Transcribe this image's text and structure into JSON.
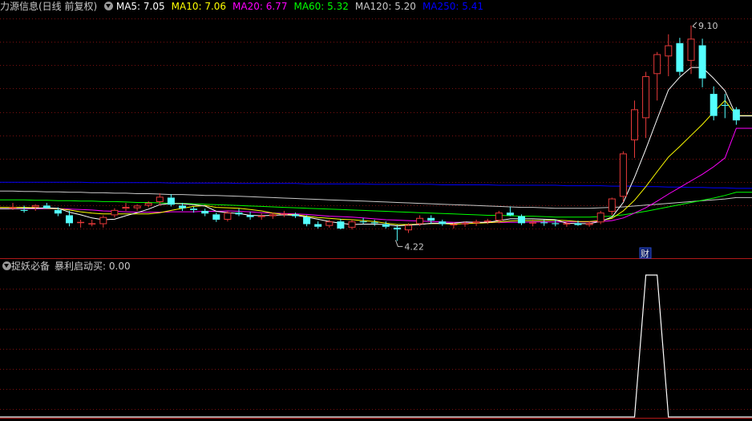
{
  "main_header": {
    "title": "力源信息(日线 前复权)",
    "ma": [
      {
        "label": "MA5: ",
        "value": "7.05",
        "color": "#ffffff"
      },
      {
        "label": "MA10: ",
        "value": "7.06",
        "color": "#ffff00"
      },
      {
        "label": "MA20: ",
        "value": "6.77",
        "color": "#ff00ff"
      },
      {
        "label": "MA60: ",
        "value": "5.32",
        "color": "#00ff00"
      },
      {
        "label": "MA120: ",
        "value": "5.20",
        "color": "#c8c8c8"
      },
      {
        "label": "MA250: ",
        "value": "5.41",
        "color": "#0000ff"
      }
    ]
  },
  "sub_header": {
    "title": "捉妖必备",
    "indicator_label": "暴利启动买: ",
    "indicator_value": "0.00"
  },
  "annotations": {
    "high_label": "9.10",
    "low_label": "4.22",
    "event_marker": "财"
  },
  "colors": {
    "background": "#000000",
    "grid": "#7a1010",
    "up": "#e83a3a",
    "down": "#54ffff",
    "panel_border": "#b01818"
  },
  "chart_data": [
    {
      "type": "candlestick",
      "title": "力源信息(日线 前复权)",
      "ylim": [
        3.9,
        9.35
      ],
      "gridlines": "dotted horizontal",
      "high": {
        "price": 9.1,
        "index": 60
      },
      "low": {
        "price": 4.22,
        "index": 34
      },
      "ohlc": [
        [
          4.95,
          5.08,
          4.92,
          4.98
        ],
        [
          4.92,
          5.02,
          4.86,
          4.9
        ],
        [
          4.98,
          5.05,
          4.9,
          5.03
        ],
        [
          5.02,
          5.08,
          4.95,
          4.96
        ],
        [
          4.92,
          4.98,
          4.78,
          4.84
        ],
        [
          4.8,
          4.9,
          4.55,
          4.62
        ],
        [
          4.65,
          4.7,
          4.52,
          4.65
        ],
        [
          4.62,
          4.7,
          4.55,
          4.62
        ],
        [
          4.6,
          4.8,
          4.52,
          4.76
        ],
        [
          4.8,
          4.96,
          4.75,
          4.92
        ],
        [
          4.95,
          5.08,
          4.9,
          4.99
        ],
        [
          4.96,
          5.05,
          4.9,
          5.02
        ],
        [
          5.02,
          5.12,
          4.98,
          5.08
        ],
        [
          5.1,
          5.3,
          5.02,
          5.22
        ],
        [
          5.2,
          5.28,
          5.0,
          5.04
        ],
        [
          5.02,
          5.08,
          4.9,
          4.96
        ],
        [
          4.95,
          4.99,
          4.86,
          4.92
        ],
        [
          4.9,
          4.95,
          4.78,
          4.84
        ],
        [
          4.82,
          4.86,
          4.65,
          4.7
        ],
        [
          4.7,
          4.9,
          4.66,
          4.86
        ],
        [
          4.86,
          4.95,
          4.78,
          4.82
        ],
        [
          4.8,
          4.88,
          4.7,
          4.76
        ],
        [
          4.76,
          4.84,
          4.7,
          4.79
        ],
        [
          4.78,
          4.86,
          4.72,
          4.82
        ],
        [
          4.82,
          4.9,
          4.76,
          4.84
        ],
        [
          4.82,
          4.86,
          4.74,
          4.78
        ],
        [
          4.76,
          4.8,
          4.55,
          4.6
        ],
        [
          4.6,
          4.66,
          4.5,
          4.54
        ],
        [
          4.56,
          4.7,
          4.52,
          4.66
        ],
        [
          4.66,
          4.72,
          4.48,
          4.5
        ],
        [
          4.52,
          4.7,
          4.48,
          4.66
        ],
        [
          4.66,
          4.74,
          4.6,
          4.64
        ],
        [
          4.64,
          4.7,
          4.56,
          4.62
        ],
        [
          4.6,
          4.66,
          4.5,
          4.54
        ],
        [
          4.52,
          4.58,
          4.22,
          4.48
        ],
        [
          4.46,
          4.62,
          4.4,
          4.58
        ],
        [
          4.6,
          4.8,
          4.56,
          4.74
        ],
        [
          4.74,
          4.8,
          4.6,
          4.68
        ],
        [
          4.66,
          4.7,
          4.56,
          4.6
        ],
        [
          4.58,
          4.64,
          4.5,
          4.6
        ],
        [
          4.6,
          4.66,
          4.54,
          4.62
        ],
        [
          4.62,
          4.7,
          4.56,
          4.66
        ],
        [
          4.66,
          4.72,
          4.6,
          4.68
        ],
        [
          4.68,
          4.9,
          4.62,
          4.86
        ],
        [
          4.86,
          5.0,
          4.78,
          4.8
        ],
        [
          4.78,
          4.82,
          4.58,
          4.62
        ],
        [
          4.62,
          4.7,
          4.55,
          4.64
        ],
        [
          4.64,
          4.7,
          4.56,
          4.62
        ],
        [
          4.62,
          4.7,
          4.55,
          4.6
        ],
        [
          4.6,
          4.66,
          4.54,
          4.62
        ],
        [
          4.62,
          4.68,
          4.56,
          4.58
        ],
        [
          4.58,
          4.66,
          4.54,
          4.62
        ],
        [
          4.64,
          4.9,
          4.6,
          4.86
        ],
        [
          4.88,
          5.2,
          4.8,
          5.18
        ],
        [
          5.22,
          6.25,
          5.1,
          6.2
        ],
        [
          6.5,
          7.4,
          6.1,
          7.2
        ],
        [
          7.0,
          8.05,
          6.55,
          7.95
        ],
        [
          8.0,
          8.5,
          7.4,
          8.45
        ],
        [
          8.4,
          8.9,
          7.95,
          8.65
        ],
        [
          8.7,
          8.82,
          7.96,
          8.05
        ],
        [
          8.3,
          9.1,
          8.0,
          8.8
        ],
        [
          8.65,
          8.8,
          7.7,
          7.9
        ],
        [
          7.55,
          7.72,
          6.95,
          7.05
        ],
        [
          7.3,
          7.55,
          7.0,
          7.28
        ],
        [
          7.2,
          7.25,
          6.85,
          6.95
        ]
      ],
      "ma_series": [
        {
          "name": "MA5",
          "color": "#ffffff",
          "values": [
            4.95,
            4.96,
            4.96,
            4.97,
            4.96,
            4.87,
            4.81,
            4.74,
            4.7,
            4.71,
            4.79,
            4.86,
            4.94,
            5.04,
            5.07,
            5.06,
            5.04,
            5.01,
            4.89,
            4.86,
            4.84,
            4.8,
            4.79,
            4.8,
            4.81,
            4.8,
            4.76,
            4.71,
            4.66,
            4.62,
            4.59,
            4.6,
            4.6,
            4.59,
            4.56,
            4.58,
            4.59,
            4.62,
            4.62,
            4.62,
            4.65,
            4.64,
            4.64,
            4.68,
            4.72,
            4.72,
            4.72,
            4.71,
            4.7,
            4.62,
            4.61,
            4.61,
            4.66,
            4.76,
            5.09,
            5.66,
            6.3,
            6.98,
            7.64,
            7.93,
            8.15,
            8.15,
            7.9,
            7.62,
            7.05
          ]
        },
        {
          "name": "MA10",
          "color": "#ffff00",
          "values": [
            4.98,
            4.98,
            4.97,
            4.96,
            4.95,
            4.92,
            4.88,
            4.85,
            4.83,
            4.83,
            4.83,
            4.83,
            4.83,
            4.86,
            4.91,
            4.96,
            5.0,
            5.02,
            4.98,
            4.97,
            4.96,
            4.93,
            4.9,
            4.85,
            4.82,
            4.82,
            4.78,
            4.75,
            4.73,
            4.71,
            4.7,
            4.68,
            4.66,
            4.62,
            4.59,
            4.59,
            4.6,
            4.61,
            4.61,
            4.6,
            4.61,
            4.62,
            4.63,
            4.65,
            4.67,
            4.68,
            4.68,
            4.68,
            4.69,
            4.68,
            4.66,
            4.66,
            4.68,
            4.73,
            4.9,
            5.14,
            5.45,
            5.79,
            6.12,
            6.36,
            6.61,
            6.86,
            7.14,
            7.4,
            7.06
          ]
        },
        {
          "name": "MA20",
          "color": "#ff00ff",
          "values": [
            4.95,
            4.95,
            4.95,
            4.95,
            4.95,
            4.94,
            4.93,
            4.92,
            4.9,
            4.89,
            4.88,
            4.87,
            4.87,
            4.87,
            4.88,
            4.88,
            4.88,
            4.89,
            4.89,
            4.9,
            4.89,
            4.88,
            4.86,
            4.85,
            4.84,
            4.83,
            4.82,
            4.8,
            4.78,
            4.77,
            4.76,
            4.74,
            4.72,
            4.7,
            4.69,
            4.68,
            4.67,
            4.66,
            4.65,
            4.64,
            4.64,
            4.64,
            4.64,
            4.64,
            4.64,
            4.64,
            4.65,
            4.65,
            4.65,
            4.65,
            4.65,
            4.65,
            4.66,
            4.68,
            4.74,
            4.85,
            4.97,
            5.12,
            5.28,
            5.43,
            5.58,
            5.73,
            5.9,
            6.1,
            6.77
          ]
        },
        {
          "name": "MA60",
          "color": "#00ff00",
          "values": [
            5.15,
            5.15,
            5.14,
            5.14,
            5.13,
            5.13,
            5.12,
            5.12,
            5.11,
            5.11,
            5.1,
            5.09,
            5.09,
            5.08,
            5.07,
            5.07,
            5.06,
            5.05,
            5.04,
            5.03,
            5.02,
            5.01,
            5.0,
            4.99,
            4.98,
            4.97,
            4.96,
            4.95,
            4.94,
            4.93,
            4.92,
            4.91,
            4.9,
            4.89,
            4.88,
            4.87,
            4.86,
            4.85,
            4.84,
            4.83,
            4.82,
            4.81,
            4.8,
            4.8,
            4.79,
            4.78,
            4.78,
            4.77,
            4.76,
            4.76,
            4.76,
            4.76,
            4.77,
            4.78,
            4.81,
            4.85,
            4.89,
            4.94,
            4.99,
            5.04,
            5.09,
            5.14,
            5.19,
            5.25,
            5.32
          ]
        },
        {
          "name": "MA120",
          "color": "#c8c8c8",
          "values": [
            5.35,
            5.34,
            5.34,
            5.33,
            5.33,
            5.32,
            5.32,
            5.31,
            5.31,
            5.3,
            5.3,
            5.29,
            5.29,
            5.28,
            5.27,
            5.27,
            5.26,
            5.25,
            5.25,
            5.24,
            5.23,
            5.22,
            5.21,
            5.2,
            5.19,
            5.18,
            5.17,
            5.16,
            5.15,
            5.14,
            5.13,
            5.12,
            5.11,
            5.1,
            5.09,
            5.08,
            5.07,
            5.06,
            5.05,
            5.04,
            5.03,
            5.02,
            5.01,
            5.0,
            4.99,
            4.98,
            4.98,
            4.97,
            4.96,
            4.96,
            4.96,
            4.96,
            4.97,
            4.98,
            4.99,
            5.01,
            5.03,
            5.05,
            5.07,
            5.09,
            5.11,
            5.13,
            5.15,
            5.17,
            5.2
          ]
        },
        {
          "name": "MA250",
          "color": "#0000ff",
          "values": [
            5.55,
            5.55,
            5.55,
            5.55,
            5.55,
            5.55,
            5.55,
            5.54,
            5.54,
            5.54,
            5.54,
            5.54,
            5.54,
            5.54,
            5.53,
            5.53,
            5.53,
            5.53,
            5.53,
            5.53,
            5.52,
            5.52,
            5.52,
            5.52,
            5.52,
            5.52,
            5.51,
            5.51,
            5.51,
            5.51,
            5.51,
            5.51,
            5.5,
            5.5,
            5.5,
            5.5,
            5.5,
            5.5,
            5.49,
            5.49,
            5.49,
            5.49,
            5.49,
            5.48,
            5.48,
            5.48,
            5.48,
            5.48,
            5.48,
            5.47,
            5.47,
            5.47,
            5.47,
            5.46,
            5.46,
            5.46,
            5.45,
            5.45,
            5.44,
            5.44,
            5.43,
            5.43,
            5.42,
            5.42,
            5.41
          ]
        }
      ]
    },
    {
      "type": "line",
      "title": "捉妖必备",
      "series": [
        {
          "name": "暴利启动买",
          "color": "#ffffff",
          "values": [
            0,
            0,
            0,
            0,
            0,
            0,
            0,
            0,
            0,
            0,
            0,
            0,
            0,
            0,
            0,
            0,
            0,
            0,
            0,
            0,
            0,
            0,
            0,
            0,
            0,
            0,
            0,
            0,
            0,
            0,
            0,
            0,
            0,
            0,
            0,
            0,
            0,
            0,
            0,
            0,
            0,
            0,
            0,
            0,
            0,
            0,
            0,
            0,
            0,
            0,
            0,
            0,
            0,
            0,
            0,
            0,
            1,
            1,
            0,
            0,
            0,
            0,
            0,
            0,
            0
          ]
        }
      ],
      "ylim": [
        0,
        1
      ],
      "gridlines": "dotted horizontal"
    }
  ]
}
